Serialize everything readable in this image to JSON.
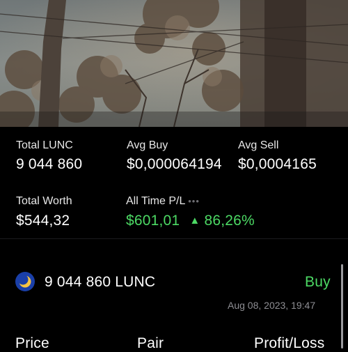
{
  "summary": {
    "total_label": "Total LUNC",
    "total_value": "9 044 860",
    "avg_buy_label": "Avg Buy",
    "avg_buy_value": "$0,000064194",
    "avg_sell_label": "Avg Sell",
    "avg_sell_value": "$0,0004165",
    "worth_label": "Total Worth",
    "worth_value": "$544,32",
    "pl_label": "All Time P/L",
    "pl_more": "•••",
    "pl_value": "$601,01",
    "pl_arrow": "▲",
    "pl_percent": "86,26%"
  },
  "transaction": {
    "amount": "9 044 860 LUNC",
    "type": "Buy",
    "date": "Aug 08, 2023, 19:47",
    "columns": [
      "Price",
      "Pair",
      "Profit/Loss"
    ]
  },
  "colors": {
    "background": "#000000",
    "positive": "#4cd964",
    "muted": "#8e8e93",
    "coin_blue": "#1a3fa8",
    "coin_moon": "#f6c343"
  },
  "icons": {
    "coin": "luna-classic-moon-icon",
    "arrow": "up-triangle-icon"
  }
}
